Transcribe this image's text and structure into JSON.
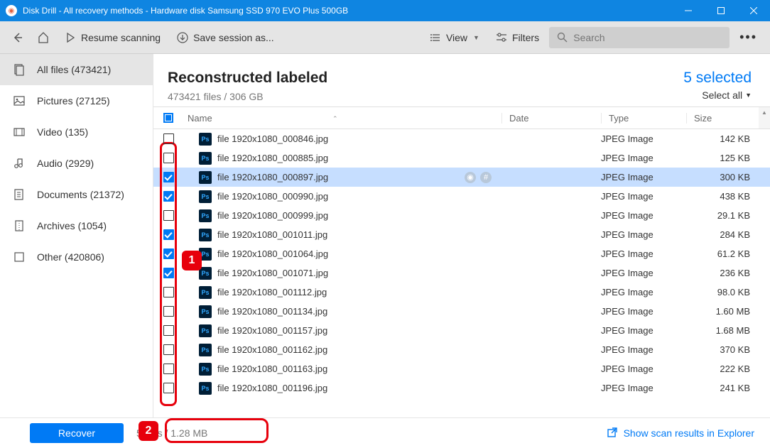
{
  "titlebar": {
    "text": "Disk Drill - All recovery methods - Hardware disk Samsung SSD 970 EVO Plus 500GB"
  },
  "toolbar": {
    "resume": "Resume scanning",
    "save": "Save session as...",
    "view": "View",
    "filters": "Filters",
    "search_placeholder": "Search"
  },
  "sidebar": {
    "items": [
      {
        "label": "All files (473421)"
      },
      {
        "label": "Pictures (27125)"
      },
      {
        "label": "Video (135)"
      },
      {
        "label": "Audio (2929)"
      },
      {
        "label": "Documents (21372)"
      },
      {
        "label": "Archives (1054)"
      },
      {
        "label": "Other (420806)"
      }
    ]
  },
  "header": {
    "title": "Reconstructed labeled",
    "subtitle": "473421 files / 306 GB",
    "selected": "5 selected",
    "select_all": "Select all"
  },
  "columns": {
    "name": "Name",
    "date": "Date",
    "type": "Type",
    "size": "Size"
  },
  "rows": [
    {
      "name": "file 1920x1080_000846.jpg",
      "type": "JPEG Image",
      "size": "142 KB",
      "checked": false,
      "sel": false
    },
    {
      "name": "file 1920x1080_000885.jpg",
      "type": "JPEG Image",
      "size": "125 KB",
      "checked": false,
      "sel": false
    },
    {
      "name": "file 1920x1080_000897.jpg",
      "type": "JPEG Image",
      "size": "300 KB",
      "checked": true,
      "sel": true
    },
    {
      "name": "file 1920x1080_000990.jpg",
      "type": "JPEG Image",
      "size": "438 KB",
      "checked": true,
      "sel": false
    },
    {
      "name": "file 1920x1080_000999.jpg",
      "type": "JPEG Image",
      "size": "29.1 KB",
      "checked": false,
      "sel": false
    },
    {
      "name": "file 1920x1080_001011.jpg",
      "type": "JPEG Image",
      "size": "284 KB",
      "checked": true,
      "sel": false
    },
    {
      "name": "file 1920x1080_001064.jpg",
      "type": "JPEG Image",
      "size": "61.2 KB",
      "checked": true,
      "sel": false
    },
    {
      "name": "file 1920x1080_001071.jpg",
      "type": "JPEG Image",
      "size": "236 KB",
      "checked": true,
      "sel": false
    },
    {
      "name": "file 1920x1080_001112.jpg",
      "type": "JPEG Image",
      "size": "98.0 KB",
      "checked": false,
      "sel": false
    },
    {
      "name": "file 1920x1080_001134.jpg",
      "type": "JPEG Image",
      "size": "1.60 MB",
      "checked": false,
      "sel": false
    },
    {
      "name": "file 1920x1080_001157.jpg",
      "type": "JPEG Image",
      "size": "1.68 MB",
      "checked": false,
      "sel": false
    },
    {
      "name": "file 1920x1080_001162.jpg",
      "type": "JPEG Image",
      "size": "370 KB",
      "checked": false,
      "sel": false
    },
    {
      "name": "file 1920x1080_001163.jpg",
      "type": "JPEG Image",
      "size": "222 KB",
      "checked": false,
      "sel": false
    },
    {
      "name": "file 1920x1080_001196.jpg",
      "type": "JPEG Image",
      "size": "241 KB",
      "checked": false,
      "sel": false
    }
  ],
  "footer": {
    "recover": "Recover",
    "counts": "5 files / 1.28 MB",
    "explorer": "Show scan results in Explorer"
  },
  "annotations": {
    "one": "1",
    "two": "2"
  }
}
